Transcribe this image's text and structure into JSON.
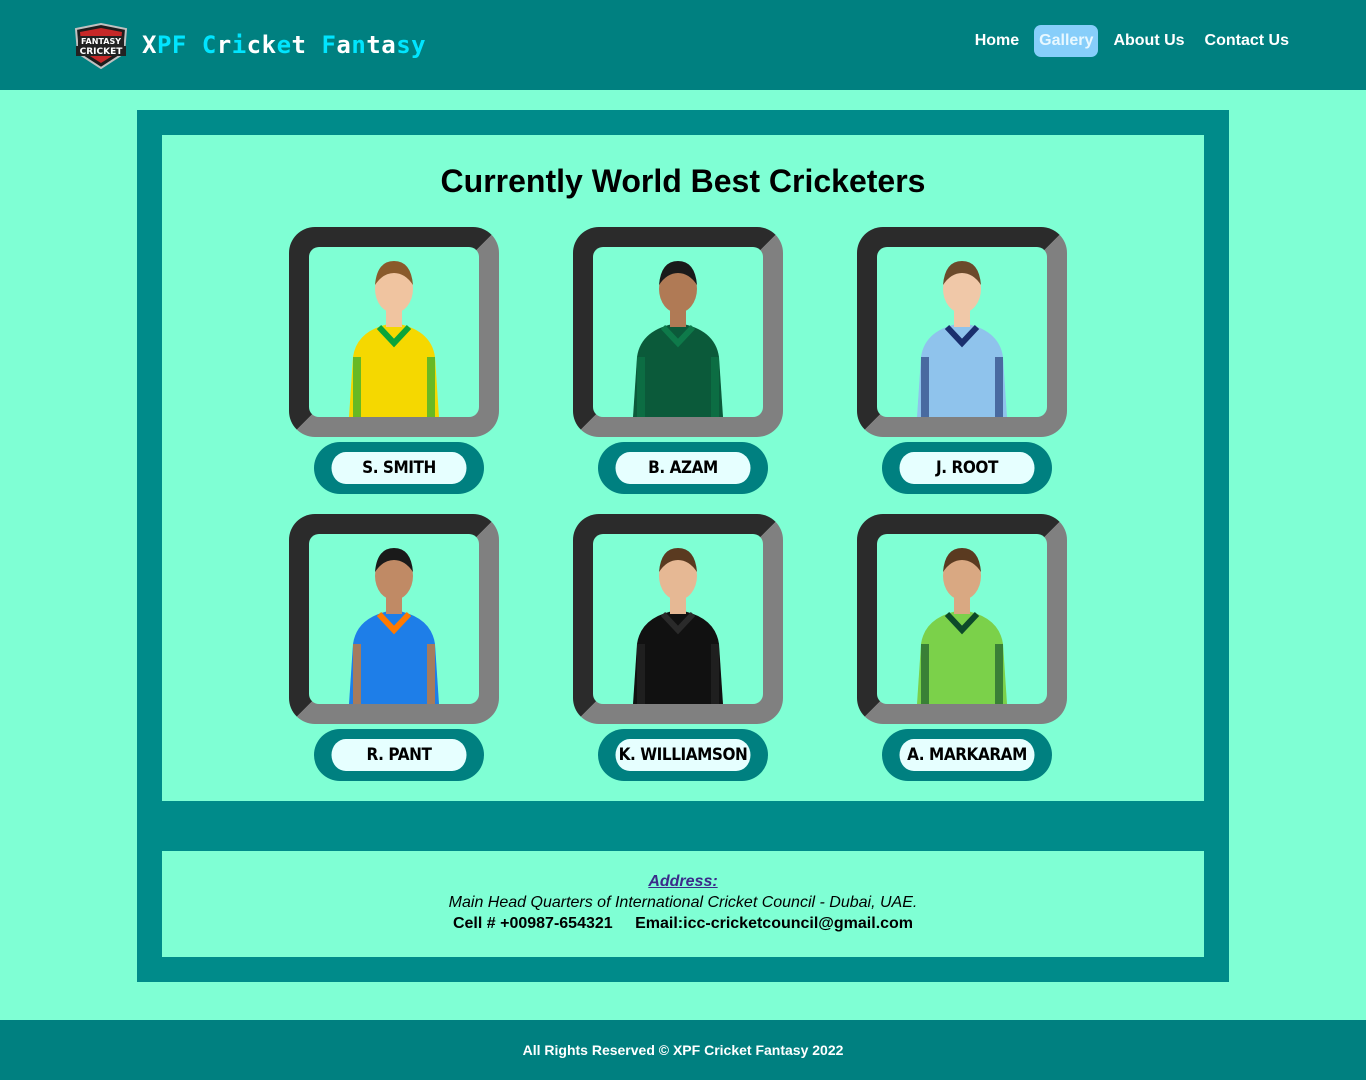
{
  "header": {
    "logo_alt": "FANTASY CRICKET",
    "brand_letters": [
      {
        "ch": "X",
        "color": "#ffffff"
      },
      {
        "ch": "P",
        "color": "#00e5ff"
      },
      {
        "ch": "F",
        "color": "#00e5ff"
      },
      {
        "ch": " ",
        "color": "#ffffff"
      },
      {
        "ch": "C",
        "color": "#00e5ff"
      },
      {
        "ch": "r",
        "color": "#ffffff"
      },
      {
        "ch": "i",
        "color": "#00e5ff"
      },
      {
        "ch": "c",
        "color": "#ffffff"
      },
      {
        "ch": "k",
        "color": "#ffffff"
      },
      {
        "ch": "e",
        "color": "#00e5ff"
      },
      {
        "ch": "t",
        "color": "#ffffff"
      },
      {
        "ch": " ",
        "color": "#ffffff"
      },
      {
        "ch": "F",
        "color": "#00e5ff"
      },
      {
        "ch": "a",
        "color": "#ffffff"
      },
      {
        "ch": "n",
        "color": "#00e5ff"
      },
      {
        "ch": "t",
        "color": "#ffffff"
      },
      {
        "ch": "a",
        "color": "#ffffff"
      },
      {
        "ch": "s",
        "color": "#00e5ff"
      },
      {
        "ch": "y",
        "color": "#00e5ff"
      }
    ],
    "nav": [
      {
        "label": "Home",
        "active": false
      },
      {
        "label": "Gallery",
        "active": true
      },
      {
        "label": "About Us",
        "active": false
      },
      {
        "label": "Contact Us",
        "active": false
      }
    ]
  },
  "gallery": {
    "title": "Currently World Best Cricketers",
    "players": [
      {
        "name": "S. SMITH",
        "kit": "#f5d800",
        "kit2": "#0aa53a",
        "hair": "#8a5a2b",
        "skin": "#f0c4a0"
      },
      {
        "name": "B. AZAM",
        "kit": "#0b5a3a",
        "kit2": "#0e7a4a",
        "hair": "#1a1a1a",
        "skin": "#b07a55"
      },
      {
        "name": "J. ROOT",
        "kit": "#8fc3ec",
        "kit2": "#1a2f6e",
        "hair": "#6b4a2b",
        "skin": "#f0c8a8"
      },
      {
        "name": "R. PANT",
        "kit": "#1e7ee8",
        "kit2": "#ff7a00",
        "hair": "#1a1a1a",
        "skin": "#c08a65"
      },
      {
        "name": "K. WILLIAMSON",
        "kit": "#111111",
        "kit2": "#2a2a2a",
        "hair": "#5a3a20",
        "skin": "#e6b894"
      },
      {
        "name": "A. MARKARAM",
        "kit": "#7bd14a",
        "kit2": "#0d4a2a",
        "hair": "#5a3a20",
        "skin": "#d9a882"
      }
    ]
  },
  "address": {
    "label": "Address:",
    "line": "Main Head Quarters of International Cricket Council - Dubai, UAE.",
    "cell": "Cell # +00987-654321",
    "email": "Email:icc-cricketcouncil@gmail.com"
  },
  "footer": {
    "text": "All Rights Reserved © XPF Cricket Fantasy 2022"
  }
}
